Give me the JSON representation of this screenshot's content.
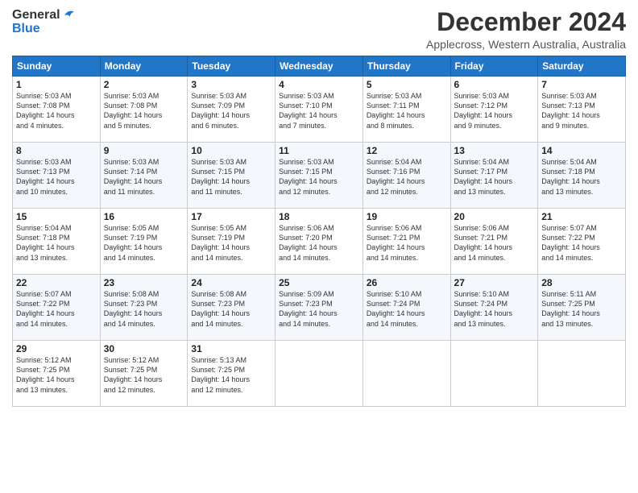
{
  "logo": {
    "line1": "General",
    "line2": "Blue"
  },
  "title": "December 2024",
  "subtitle": "Applecross, Western Australia, Australia",
  "days_of_week": [
    "Sunday",
    "Monday",
    "Tuesday",
    "Wednesday",
    "Thursday",
    "Friday",
    "Saturday"
  ],
  "weeks": [
    [
      {
        "day": "1",
        "info": "Sunrise: 5:03 AM\nSunset: 7:08 PM\nDaylight: 14 hours\nand 4 minutes."
      },
      {
        "day": "2",
        "info": "Sunrise: 5:03 AM\nSunset: 7:08 PM\nDaylight: 14 hours\nand 5 minutes."
      },
      {
        "day": "3",
        "info": "Sunrise: 5:03 AM\nSunset: 7:09 PM\nDaylight: 14 hours\nand 6 minutes."
      },
      {
        "day": "4",
        "info": "Sunrise: 5:03 AM\nSunset: 7:10 PM\nDaylight: 14 hours\nand 7 minutes."
      },
      {
        "day": "5",
        "info": "Sunrise: 5:03 AM\nSunset: 7:11 PM\nDaylight: 14 hours\nand 8 minutes."
      },
      {
        "day": "6",
        "info": "Sunrise: 5:03 AM\nSunset: 7:12 PM\nDaylight: 14 hours\nand 9 minutes."
      },
      {
        "day": "7",
        "info": "Sunrise: 5:03 AM\nSunset: 7:13 PM\nDaylight: 14 hours\nand 9 minutes."
      }
    ],
    [
      {
        "day": "8",
        "info": "Sunrise: 5:03 AM\nSunset: 7:13 PM\nDaylight: 14 hours\nand 10 minutes."
      },
      {
        "day": "9",
        "info": "Sunrise: 5:03 AM\nSunset: 7:14 PM\nDaylight: 14 hours\nand 11 minutes."
      },
      {
        "day": "10",
        "info": "Sunrise: 5:03 AM\nSunset: 7:15 PM\nDaylight: 14 hours\nand 11 minutes."
      },
      {
        "day": "11",
        "info": "Sunrise: 5:03 AM\nSunset: 7:15 PM\nDaylight: 14 hours\nand 12 minutes."
      },
      {
        "day": "12",
        "info": "Sunrise: 5:04 AM\nSunset: 7:16 PM\nDaylight: 14 hours\nand 12 minutes."
      },
      {
        "day": "13",
        "info": "Sunrise: 5:04 AM\nSunset: 7:17 PM\nDaylight: 14 hours\nand 13 minutes."
      },
      {
        "day": "14",
        "info": "Sunrise: 5:04 AM\nSunset: 7:18 PM\nDaylight: 14 hours\nand 13 minutes."
      }
    ],
    [
      {
        "day": "15",
        "info": "Sunrise: 5:04 AM\nSunset: 7:18 PM\nDaylight: 14 hours\nand 13 minutes."
      },
      {
        "day": "16",
        "info": "Sunrise: 5:05 AM\nSunset: 7:19 PM\nDaylight: 14 hours\nand 14 minutes."
      },
      {
        "day": "17",
        "info": "Sunrise: 5:05 AM\nSunset: 7:19 PM\nDaylight: 14 hours\nand 14 minutes."
      },
      {
        "day": "18",
        "info": "Sunrise: 5:06 AM\nSunset: 7:20 PM\nDaylight: 14 hours\nand 14 minutes."
      },
      {
        "day": "19",
        "info": "Sunrise: 5:06 AM\nSunset: 7:21 PM\nDaylight: 14 hours\nand 14 minutes."
      },
      {
        "day": "20",
        "info": "Sunrise: 5:06 AM\nSunset: 7:21 PM\nDaylight: 14 hours\nand 14 minutes."
      },
      {
        "day": "21",
        "info": "Sunrise: 5:07 AM\nSunset: 7:22 PM\nDaylight: 14 hours\nand 14 minutes."
      }
    ],
    [
      {
        "day": "22",
        "info": "Sunrise: 5:07 AM\nSunset: 7:22 PM\nDaylight: 14 hours\nand 14 minutes."
      },
      {
        "day": "23",
        "info": "Sunrise: 5:08 AM\nSunset: 7:23 PM\nDaylight: 14 hours\nand 14 minutes."
      },
      {
        "day": "24",
        "info": "Sunrise: 5:08 AM\nSunset: 7:23 PM\nDaylight: 14 hours\nand 14 minutes."
      },
      {
        "day": "25",
        "info": "Sunrise: 5:09 AM\nSunset: 7:23 PM\nDaylight: 14 hours\nand 14 minutes."
      },
      {
        "day": "26",
        "info": "Sunrise: 5:10 AM\nSunset: 7:24 PM\nDaylight: 14 hours\nand 14 minutes."
      },
      {
        "day": "27",
        "info": "Sunrise: 5:10 AM\nSunset: 7:24 PM\nDaylight: 14 hours\nand 13 minutes."
      },
      {
        "day": "28",
        "info": "Sunrise: 5:11 AM\nSunset: 7:25 PM\nDaylight: 14 hours\nand 13 minutes."
      }
    ],
    [
      {
        "day": "29",
        "info": "Sunrise: 5:12 AM\nSunset: 7:25 PM\nDaylight: 14 hours\nand 13 minutes."
      },
      {
        "day": "30",
        "info": "Sunrise: 5:12 AM\nSunset: 7:25 PM\nDaylight: 14 hours\nand 12 minutes."
      },
      {
        "day": "31",
        "info": "Sunrise: 5:13 AM\nSunset: 7:25 PM\nDaylight: 14 hours\nand 12 minutes."
      },
      null,
      null,
      null,
      null
    ]
  ]
}
